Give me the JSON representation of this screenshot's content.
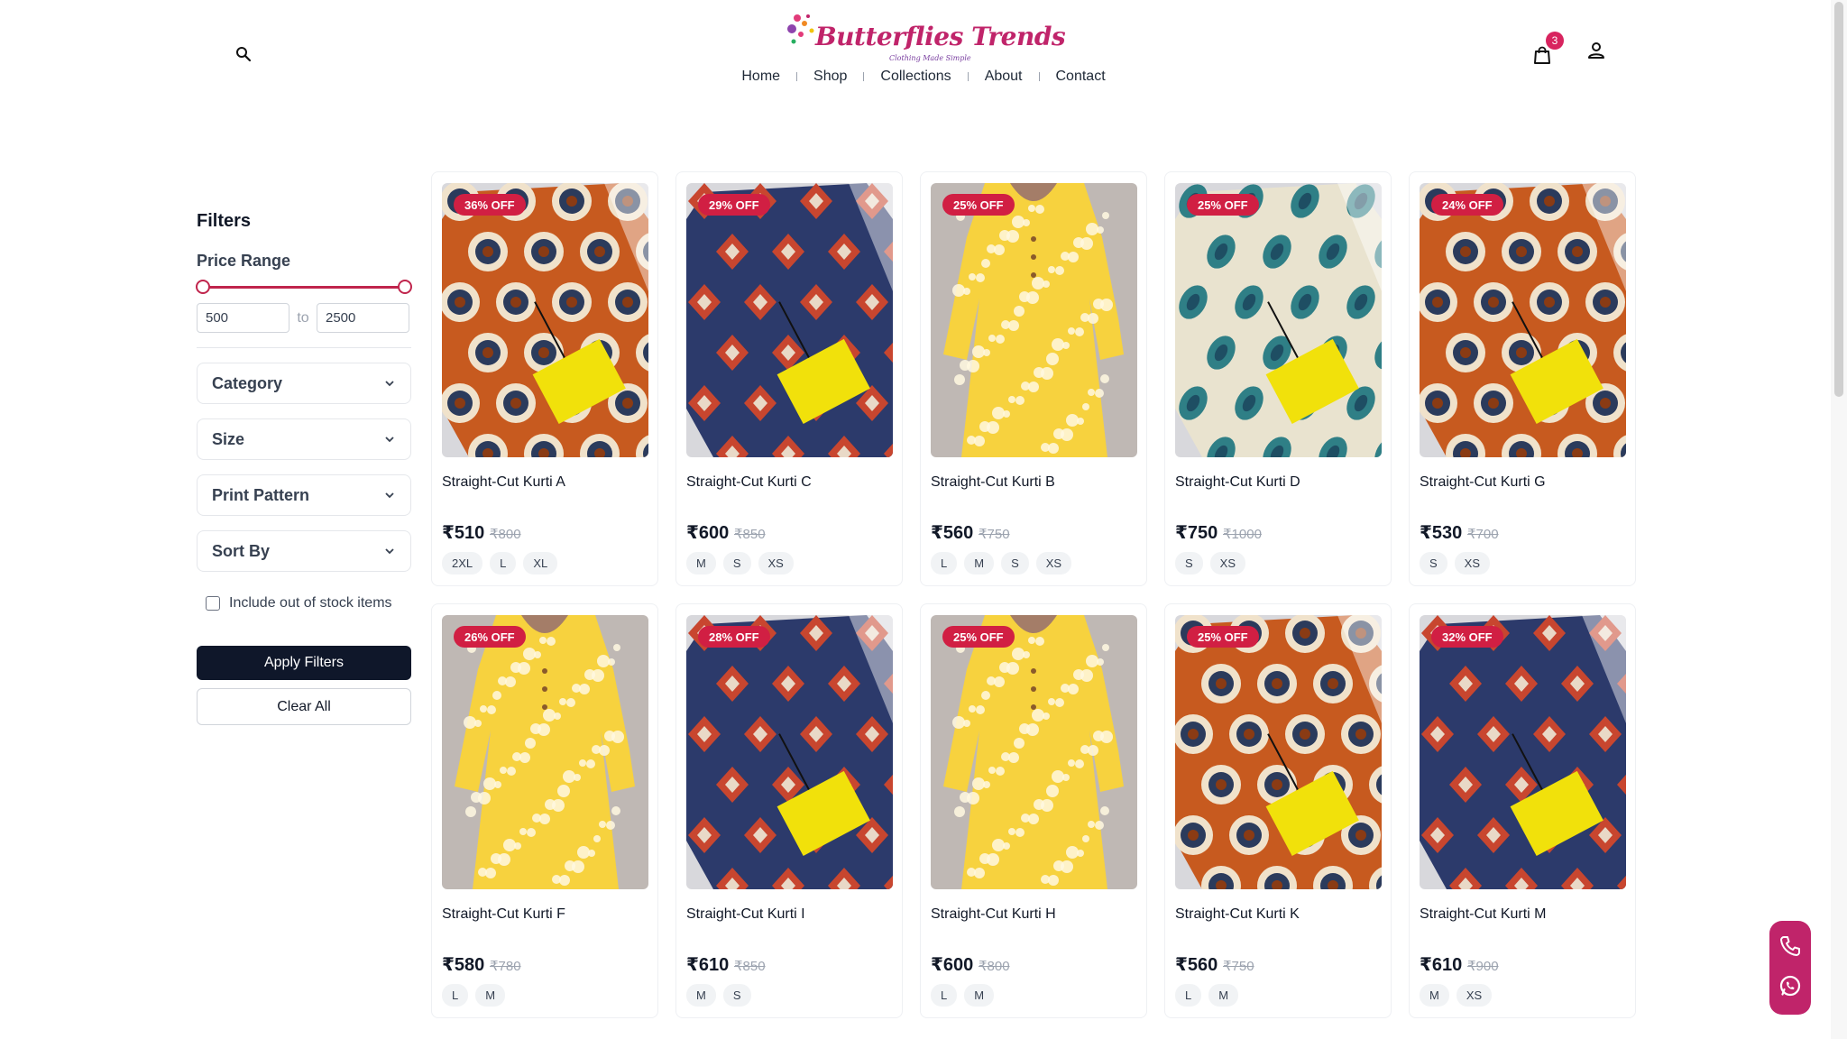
{
  "header": {
    "brand": "Butterflies Trends",
    "tagline": "Clothing Made Simple",
    "nav": [
      "Home",
      "Shop",
      "Collections",
      "About",
      "Contact"
    ],
    "cart_count": "3",
    "icons": {
      "search": "search-icon",
      "cart": "shopping-bag-icon",
      "account": "user-icon"
    }
  },
  "filters": {
    "title": "Filters",
    "price_range_label": "Price Range",
    "min_price": "500",
    "max_price": "2500",
    "to_label": "to",
    "dropdowns": [
      "Category",
      "Size",
      "Print Pattern",
      "Sort By"
    ],
    "out_of_stock_label": "Include out of stock items",
    "apply_label": "Apply Filters",
    "clear_label": "Clear All"
  },
  "products": [
    {
      "name": "Straight-Cut Kurti A",
      "discount": "36% OFF",
      "price": "₹510",
      "mrp": "₹800",
      "sizes": [
        "2XL",
        "L",
        "XL"
      ],
      "print": "orange-medallion"
    },
    {
      "name": "Straight-Cut Kurti C",
      "discount": "29% OFF",
      "price": "₹600",
      "mrp": "₹850",
      "sizes": [
        "M",
        "S",
        "XS"
      ],
      "print": "navy-ikat"
    },
    {
      "name": "Straight-Cut Kurti B",
      "discount": "25% OFF",
      "price": "₹560",
      "mrp": "₹750",
      "sizes": [
        "L",
        "M",
        "S",
        "XS"
      ],
      "print": "yellow-floral-dress"
    },
    {
      "name": "Straight-Cut Kurti D",
      "discount": "25% OFF",
      "price": "₹750",
      "mrp": "₹1000",
      "sizes": [
        "S",
        "XS"
      ],
      "print": "teal-paisley"
    },
    {
      "name": "Straight-Cut Kurti G",
      "discount": "24% OFF",
      "price": "₹530",
      "mrp": "₹700",
      "sizes": [
        "S",
        "XS"
      ],
      "print": "orange-medallion"
    },
    {
      "name": "Straight-Cut Kurti F",
      "discount": "26% OFF",
      "price": "₹580",
      "mrp": "₹780",
      "sizes": [
        "L",
        "M"
      ],
      "print": "yellow-floral-dress"
    },
    {
      "name": "Straight-Cut Kurti I",
      "discount": "28% OFF",
      "price": "₹610",
      "mrp": "₹850",
      "sizes": [
        "M",
        "S"
      ],
      "print": "navy-ikat"
    },
    {
      "name": "Straight-Cut Kurti H",
      "discount": "25% OFF",
      "price": "₹600",
      "mrp": "₹800",
      "sizes": [
        "L",
        "M"
      ],
      "print": "yellow-floral-dress"
    },
    {
      "name": "Straight-Cut Kurti K",
      "discount": "25% OFF",
      "price": "₹560",
      "mrp": "₹750",
      "sizes": [
        "L",
        "M"
      ],
      "print": "orange-medallion"
    },
    {
      "name": "Straight-Cut Kurti M",
      "discount": "32% OFF",
      "price": "₹610",
      "mrp": "₹900",
      "sizes": [
        "M",
        "XS"
      ],
      "print": "navy-ikat"
    }
  ],
  "floating": {
    "icons": [
      "phone-icon",
      "whatsapp-icon"
    ]
  },
  "colors": {
    "accent": "#c0246a",
    "badge": "#d11f43",
    "dark_button": "#0f172a",
    "slider": "#c0244c"
  }
}
